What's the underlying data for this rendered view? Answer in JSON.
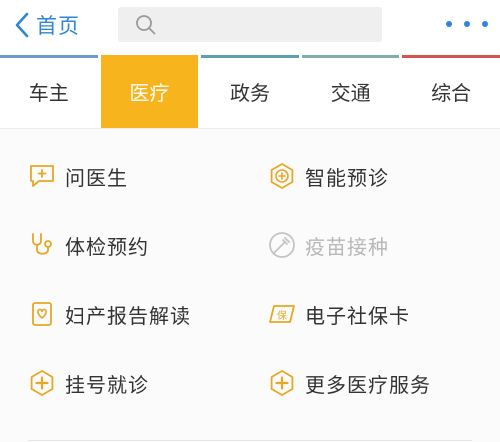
{
  "header": {
    "back_label": "首页",
    "search_placeholder": "",
    "back_icon": "chevron-left-icon",
    "search_icon": "search-icon",
    "more_icon": "more-dots-icon"
  },
  "tabs": [
    {
      "label": "车主",
      "active": false,
      "color": "#6c9bd2"
    },
    {
      "label": "医疗",
      "active": true,
      "color": "#f8b41c"
    },
    {
      "label": "政务",
      "active": false,
      "color": "#5c9fb0"
    },
    {
      "label": "交通",
      "active": false,
      "color": "#7fb0a8"
    },
    {
      "label": "综合",
      "active": false,
      "color": "#d9534f"
    }
  ],
  "services": [
    {
      "label": "问医生",
      "icon": "chat-doctor-icon",
      "enabled": true
    },
    {
      "label": "智能预诊",
      "icon": "smart-diagnosis-icon",
      "enabled": true
    },
    {
      "label": "体检预约",
      "icon": "stethoscope-icon",
      "enabled": true
    },
    {
      "label": "疫苗接种",
      "icon": "vaccine-icon",
      "enabled": false
    },
    {
      "label": "妇产报告解读",
      "icon": "maternity-report-icon",
      "enabled": true
    },
    {
      "label": "电子社保卡",
      "icon": "social-security-card-icon",
      "enabled": true
    },
    {
      "label": "挂号就诊",
      "icon": "registration-icon",
      "enabled": true
    },
    {
      "label": "更多医疗服务",
      "icon": "more-services-icon",
      "enabled": true
    }
  ],
  "colors": {
    "accent": "#f8b41c",
    "brand_blue": "#2f86d8",
    "disabled": "#c4c4c4"
  }
}
